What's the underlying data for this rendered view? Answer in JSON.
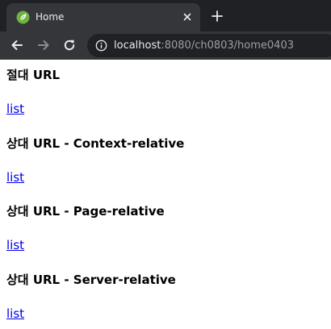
{
  "browser": {
    "tab_title": "Home",
    "url_host": "localhost",
    "url_rest": ":8080/ch0803/home0403",
    "favicon_icon": "spring-leaf-icon",
    "accent_color": "#6db33f"
  },
  "page": {
    "sections": [
      {
        "heading": "절대 URL",
        "link": "list"
      },
      {
        "heading": "상대 URL - Context-relative",
        "link": "list"
      },
      {
        "heading": "상대 URL - Page-relative",
        "link": "list"
      },
      {
        "heading": "상대 URL - Server-relative",
        "link": "list"
      }
    ]
  }
}
